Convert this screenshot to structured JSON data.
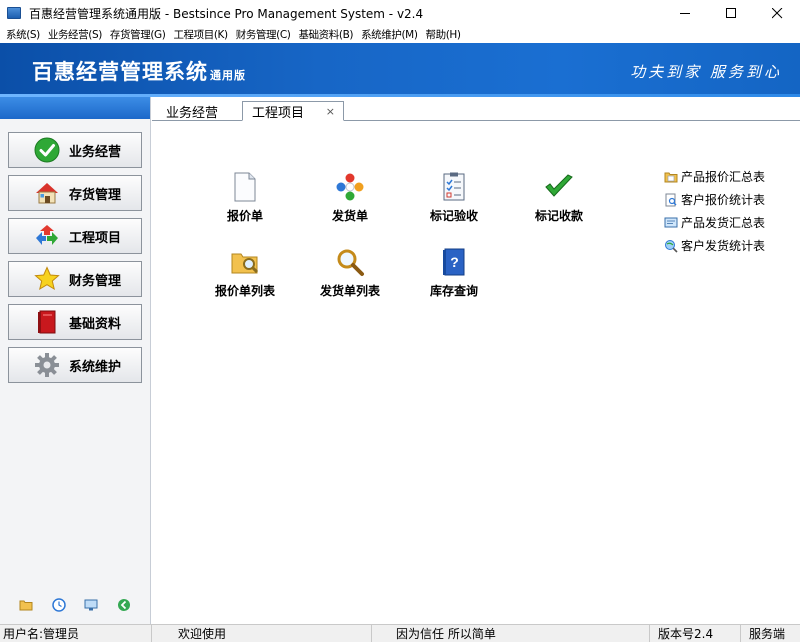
{
  "window": {
    "title": "百惠经营管理系统通用版 - Bestsince Pro Management System - v2.4",
    "controls": {
      "minimize": "—",
      "maximize": "☐",
      "close": "✕"
    }
  },
  "menu": [
    "系统(S)",
    "业务经营(S)",
    "存货管理(G)",
    "工程项目(K)",
    "财务管理(C)",
    "基础资料(B)",
    "系统维护(M)",
    "帮助(H)"
  ],
  "banner": {
    "brand": "百惠经营管理系统",
    "brand_sub": "通用版",
    "slogan": "功夫到家 服务到心"
  },
  "sidebar": {
    "items": [
      {
        "label": "业务经营",
        "icon": "green-check-icon"
      },
      {
        "label": "存货管理",
        "icon": "house-icon"
      },
      {
        "label": "工程项目",
        "icon": "recycle-arrows-icon"
      },
      {
        "label": "财务管理",
        "icon": "star-icon"
      },
      {
        "label": "基础资料",
        "icon": "red-book-icon"
      },
      {
        "label": "系统维护",
        "icon": "gear-icon"
      }
    ],
    "tools": [
      "folder-icon",
      "clock-icon",
      "monitor-icon",
      "back-arrow-icon"
    ]
  },
  "tabs": {
    "inactive": "业务经营",
    "active": "工程项目",
    "close": "×"
  },
  "launchers": [
    {
      "label": "报价单",
      "icon": "document-icon"
    },
    {
      "label": "发货单",
      "icon": "colorful-ring-icon"
    },
    {
      "label": "标记验收",
      "icon": "checklist-icon"
    },
    {
      "label": "标记收款",
      "icon": "green-checkmark-icon"
    },
    {
      "label": "报价单列表",
      "icon": "folder-search-icon"
    },
    {
      "label": "发货单列表",
      "icon": "magnifier-icon"
    },
    {
      "label": "库存查询",
      "icon": "help-book-icon"
    }
  ],
  "reports": [
    {
      "label": "产品报价汇总表",
      "icon": "folder-doc-icon"
    },
    {
      "label": "客户报价统计表",
      "icon": "doc-search-icon"
    },
    {
      "label": "产品发货汇总表",
      "icon": "screen-doc-icon"
    },
    {
      "label": "客户发货统计表",
      "icon": "globe-search-icon"
    }
  ],
  "status": {
    "user": "用户名:管理员",
    "welcome": "欢迎使用",
    "motto": "因为信任 所以简单",
    "version": "版本号2.4",
    "mode": "服务端"
  },
  "colors": {
    "banner_blue": "#1766c6",
    "sidebar_bg": "#f3f4f6"
  }
}
